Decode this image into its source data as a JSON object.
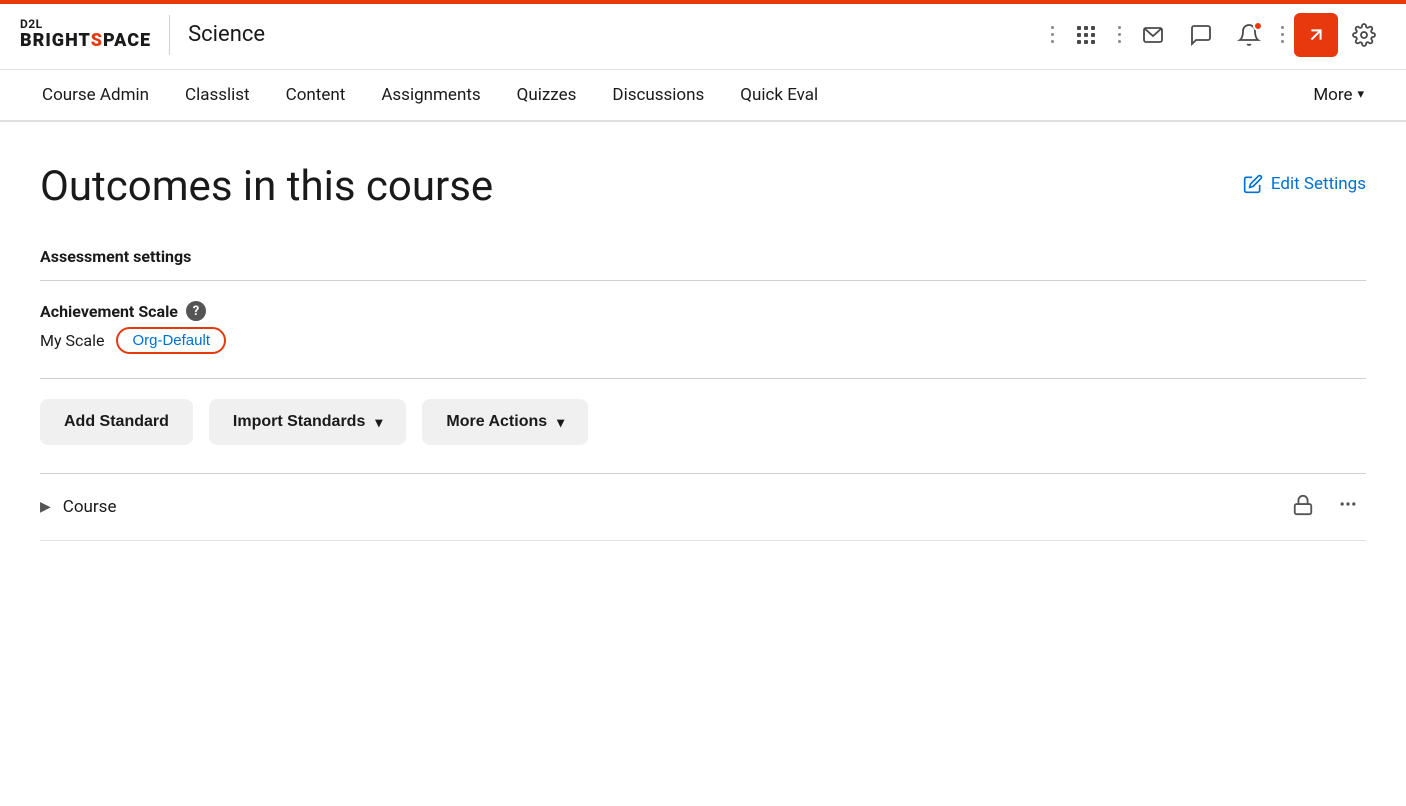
{
  "brand": {
    "d2l": "D2L",
    "brightspace_pre": "BRIGHT",
    "brightspace_accent": "S",
    "brightspace_post": "PACE"
  },
  "header": {
    "course_name": "Science",
    "icons": {
      "grid": "⊞",
      "mail": "✉",
      "chat": "💬",
      "bell": "🔔",
      "active_tool": "↗",
      "settings": "⚙"
    }
  },
  "navbar": {
    "items": [
      {
        "label": "Course Admin",
        "key": "course-admin"
      },
      {
        "label": "Classlist",
        "key": "classlist"
      },
      {
        "label": "Content",
        "key": "content"
      },
      {
        "label": "Assignments",
        "key": "assignments"
      },
      {
        "label": "Quizzes",
        "key": "quizzes"
      },
      {
        "label": "Discussions",
        "key": "discussions"
      },
      {
        "label": "Quick Eval",
        "key": "quick-eval"
      }
    ],
    "more_label": "More"
  },
  "page": {
    "title": "Outcomes in this course",
    "edit_settings_label": "Edit Settings"
  },
  "assessment": {
    "section_label": "Assessment settings",
    "achievement_scale_label": "Achievement Scale",
    "my_scale_label": "My Scale",
    "org_default_badge": "Org-Default"
  },
  "buttons": {
    "add_standard": "Add Standard",
    "import_standards": "Import Standards",
    "more_actions": "More Actions"
  },
  "course_row": {
    "label": "Course"
  }
}
